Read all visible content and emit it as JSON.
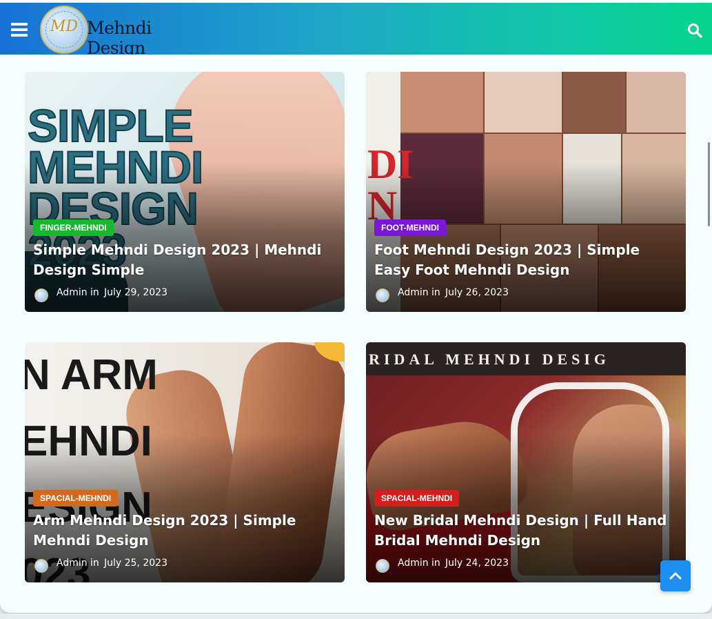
{
  "header": {
    "logo_monogram": "MD",
    "site_name": "Mehndi Design",
    "menu_icon": "hamburger-menu-icon",
    "search_icon": "search-icon",
    "gradient_start": "#1672d6",
    "gradient_end": "#06d38d"
  },
  "posts": [
    {
      "category": "FINGER-MEHNDI",
      "category_color": "#16b82e",
      "title": "Simple Mehndi Design 2023 | Mehndi Design Simple",
      "author": "Admin",
      "in_text": "in",
      "date": "July 29, 2023",
      "image_text": "SIMPLE\nMEHNDI\nDESIGN\n2023"
    },
    {
      "category": "FOOT-MEHNDI",
      "category_color": "#7a16d6",
      "title": "Foot Mehndi Design 2023 | Simple Easy Foot Mehndi Design",
      "author": "Admin",
      "in_text": "in",
      "date": "July 26, 2023",
      "image_text": "DI\nN"
    },
    {
      "category": "SPACIAL-MEHNDI",
      "category_color": "#d2691e",
      "title": "Arm Mehndi Design 2023 | Simple Mehndi Design",
      "author": "Admin",
      "in_text": "in",
      "date": "July 25, 2023",
      "image_text": "N ARM\nEHNDI\nESIGN\n023"
    },
    {
      "category": "SPACIAL-MEHNDI",
      "category_color": "#d41d1d",
      "title": "New Bridal Mehndi Design | Full Hand Bridal Mehndi Design",
      "author": "Admin",
      "in_text": "in",
      "date": "July 24, 2023",
      "image_text": "RIDAL MEHNDI DESIG"
    }
  ],
  "scroll_to_top_icon": "chevron-up-icon"
}
